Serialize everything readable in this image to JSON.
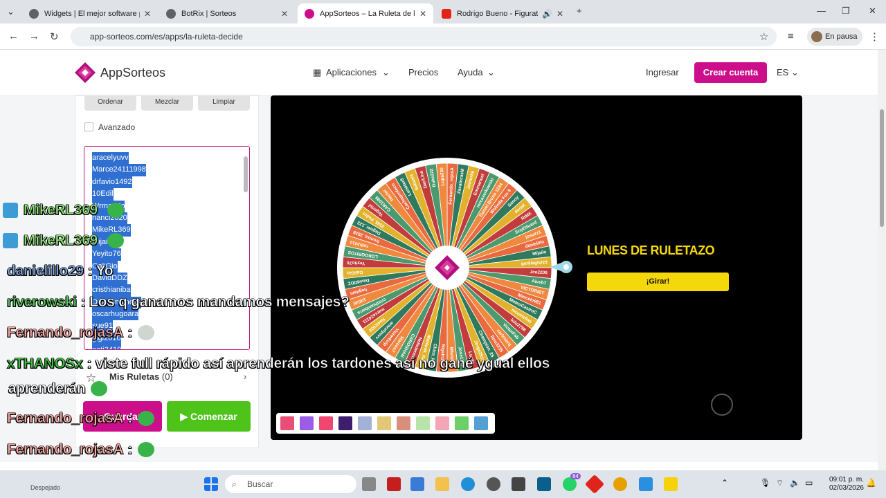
{
  "browser": {
    "tabs": [
      {
        "title": "Widgets | El mejor software par",
        "active": false
      },
      {
        "title": "BotRix | Sorteos",
        "active": false
      },
      {
        "title": "AppSorteos – La Ruleta de la Su",
        "active": true
      },
      {
        "title": "Rodrigo Bueno - Figurate tu",
        "active": false
      }
    ],
    "url": "app-sorteos.com/es/apps/la-ruleta-decide",
    "profile_label": "En pausa"
  },
  "site": {
    "logo": "AppSorteos",
    "nav": {
      "apps": "Aplicaciones",
      "prices": "Precios",
      "help": "Ayuda",
      "login": "Ingresar",
      "create": "Crear cuenta",
      "lang": "ES"
    }
  },
  "panel": {
    "sort": "Ordenar",
    "shuffle": "Mezclar",
    "clear": "Limpiar",
    "advanced": "Avanzado",
    "names": [
      "aracelyuvv",
      "Marce24111998",
      "drfavio1492",
      "10Edil",
      "Wrmando",
      "nanci2020",
      "MikeRL369",
      "Mijailo0",
      "Yeyito76",
      "GaliGio",
      "DavidDDZ",
      "cristhianiba",
      "DeAnimalness",
      "oscarhugoara",
      "sue91",
      "gigi2010",
      "nati3410"
    ],
    "my_wheels": "Mis Ruletas",
    "my_wheels_count": "(0)",
    "save": "Guardar",
    "start": "▶ Comenzar"
  },
  "stage": {
    "title": "LUNES DE RULETAZO",
    "spin": "¡Girar!"
  },
  "chat": [
    {
      "user": "MikeRL369",
      "message": "",
      "user_color": "#8fe27a"
    },
    {
      "user": "MikeRL369",
      "message": "",
      "user_color": "#8fe27a"
    },
    {
      "user": "danielillo29",
      "message": ": Yo",
      "user_color": "#7da4d8"
    },
    {
      "user": "riverowski",
      "message": ": Los q ganamos mandamos mensajes?",
      "user_color": "#59c95c"
    },
    {
      "user": "Fernando_rojasA",
      "message": ":",
      "user_color": "#f4a7a3"
    },
    {
      "user": "xTHANOSx",
      "message": ": viste full rápido así aprenderán los tardones así no gané ygual ellos",
      "user_color": "#3fbf3f"
    },
    {
      "user": "",
      "message": "aprenderán",
      "user_color": "#ffffff"
    },
    {
      "user": "Fernando_rojasA",
      "message": ":",
      "user_color": "#f4a7a3"
    },
    {
      "user": "Fernando_rojasA",
      "message": ":",
      "user_color": "#f4a7a3"
    },
    {
      "user": "Fernando_rojasA",
      "message": ":",
      "user_color": "#f4a7a3"
    }
  ],
  "taskbar": {
    "search": "Buscar",
    "weather": "Despejado",
    "time": "09:01 p. m.",
    "date": "02/03/2026",
    "badge_count": "84"
  },
  "wheel_names": [
    "Fernando_rojasA",
    "ZacatecasM",
    "Jonforkk",
    "Emmanuel",
    "mrcaverkowski",
    "Daniel Bruno 1234",
    "Wolinda Fox 9",
    "Sanoy",
    "dereK",
    "RtMX",
    "SoyEduard",
    "josuzz1",
    "danielillo",
    "Mijailo",
    "gerillagh223",
    "Jce2206",
    "Aiveb7",
    "VICTORIBT",
    "Marcelo981",
    "MateoCastroC",
    "mcentellas",
    "lulu2798",
    "VictorFab",
    "carlosarq",
    "liciu3235",
    "Champion_25",
    "Jorge2510",
    "Lucito",
    "Jose1202",
    "Mfondeuz",
    "Nigeln1980",
    "Chica_kiss",
    "Mahlunk_Kalo",
    "Nelinlenunn",
    "CAROSHAN",
    "Marcos7",
    "VictorEclp",
    "aracelyuvv",
    "Nasi2020",
    "marce24111",
    "cristhianibarra",
    "10Edil",
    "hegitam",
    "DavidDDZ",
    "GaliGio",
    "Yeyito76",
    "LOBOGRITOS",
    "ruth2410",
    "frontxz_2528",
    "Dagner_123",
    "2345_Pedro",
    "Yegertsl",
    "CAR1099",
    "hector",
    "Cacheprofeco",
    "LuisHer8",
    "Sebast1",
    "DariLina",
    "Duke222",
    "Lupa230"
  ],
  "colors": {
    "brand": "#cc0e8b",
    "start_button": "#4ec41a",
    "spin_button": "#f5d80a",
    "wheel_segments": [
      "#e96a3e",
      "#2f7a5c",
      "#e3b22c",
      "#c23c3c",
      "#4a9a6e",
      "#f0883e"
    ]
  }
}
